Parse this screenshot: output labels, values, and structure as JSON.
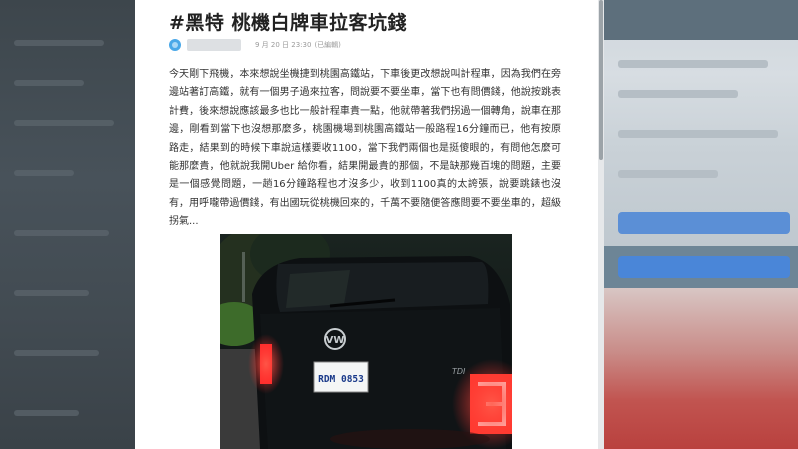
{
  "article": {
    "title": "#黑特 桃機白牌車拉客坑錢",
    "date": "9 月 20 日 23:30",
    "edited": "(已編輯)",
    "paragraph": "今天剛下飛機，本來想說坐機捷到桃園高鐵站，下車後更改想說叫計程車，因為我們在旁邊站著訂高鐵，就有一個男子過來拉客，問說要不要坐車，當下也有問價錢，他說按跳表計費，後來想說應該最多也比一般計程車貴一點，他就帶著我們拐過一個轉角，說車在那邊，剛看到當下也沒想那麼多，桃園機場到桃園高鐵站一般路程16分鐘而已，他有按原路走，結果到的時候下車說這樣要收1100，當下我們兩個也是挺傻眼的，有問他怎麼可能那麼貴，他就說我開Uber 給你看，結果開最貴的那個，不是缺那幾百塊的問題，主要是一個感覺問題，一趟16分鐘路程也才沒多少，收到1100真的太誇張，說要跳錶也沒有，用呼嚨帶過價錢，有出國玩從桃機回來的，千萬不要隨便答應問要不要坐車的，超級拐氣..."
  },
  "photo": {
    "plate_text": "RDM 0853",
    "badge_text": "TDI"
  },
  "colors": {
    "accent_blue": "#4aa8e8",
    "tail_light": "#ff2a2a"
  }
}
